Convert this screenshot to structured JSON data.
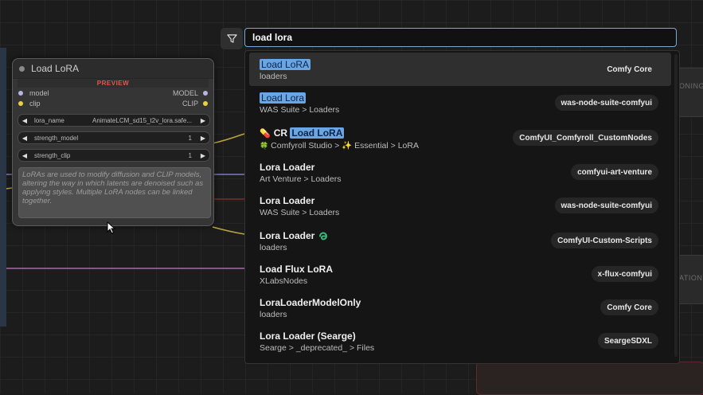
{
  "node": {
    "title": "Load LoRA",
    "preview_label": "PREVIEW",
    "inputs": [
      "model",
      "clip"
    ],
    "outputs": [
      "MODEL",
      "CLIP"
    ],
    "widgets": [
      {
        "name": "lora_name",
        "value": "AnimateLCM_sd15_t2v_lora.safe..."
      },
      {
        "name": "strength_model",
        "value": "1"
      },
      {
        "name": "strength_clip",
        "value": "1"
      }
    ],
    "description": "LoRAs are used to modify diffusion and CLIP models, altering the way in which latents are denoised such as applying styles. Multiple LoRA nodes can be linked together."
  },
  "background_text": {
    "right_top": "ONING",
    "right_mid": "ATIONING"
  },
  "search": {
    "query": "load lora",
    "filter_icon": "filter-icon"
  },
  "results": [
    {
      "title_pre": "",
      "title_hl": "Load LoRA",
      "title_post": "",
      "subtitle": "loaders",
      "badge": "Comfy Core",
      "selected": true
    },
    {
      "title_pre": "",
      "title_hl": "Load Lora",
      "title_post": "",
      "subtitle": "WAS Suite > Loaders",
      "badge": "was-node-suite-comfyui"
    },
    {
      "title_pre": "CR ",
      "title_hl": "Load LoRA",
      "title_post": "",
      "subtitle": "Comfyroll Studio > ✨ Essential > LoRA",
      "badge": "ComfyUI_Comfyroll_CustomNodes",
      "icon": "pill-icon",
      "sub_icon": "clover-icon",
      "sub_icon2": "pill-icon"
    },
    {
      "title_pre": "Lora Loader",
      "title_hl": "",
      "title_post": "",
      "subtitle": "Art Venture > Loaders",
      "badge": "comfyui-art-venture"
    },
    {
      "title_pre": "Lora Loader",
      "title_hl": "",
      "title_post": "",
      "subtitle": "WAS Suite > Loaders",
      "badge": "was-node-suite-comfyui"
    },
    {
      "title_pre": "Lora Loader",
      "title_hl": "",
      "title_post": "",
      "subtitle": "loaders",
      "badge": "ComfyUI-Custom-Scripts",
      "icon_after": "snake-icon"
    },
    {
      "title_pre": "Load Flux LoRA",
      "title_hl": "",
      "title_post": "",
      "subtitle": "XLabsNodes",
      "badge": "x-flux-comfyui"
    },
    {
      "title_pre": "LoraLoaderModelOnly",
      "title_hl": "",
      "title_post": "",
      "subtitle": "loaders",
      "badge": "Comfy Core"
    },
    {
      "title_pre": "Lora Loader (Searge)",
      "title_hl": "",
      "title_post": "",
      "subtitle": "Searge > _deprecated_ > Files",
      "badge": "SeargeSDXL"
    }
  ],
  "colors": {
    "highlight": "#6aa6e6",
    "search_border": "#7aa8d8",
    "preview_red": "#e05a4a",
    "wire_yellow": "#b8a640",
    "wire_purple": "#a86aa8",
    "wire_lilac": "#8b8bd0"
  }
}
